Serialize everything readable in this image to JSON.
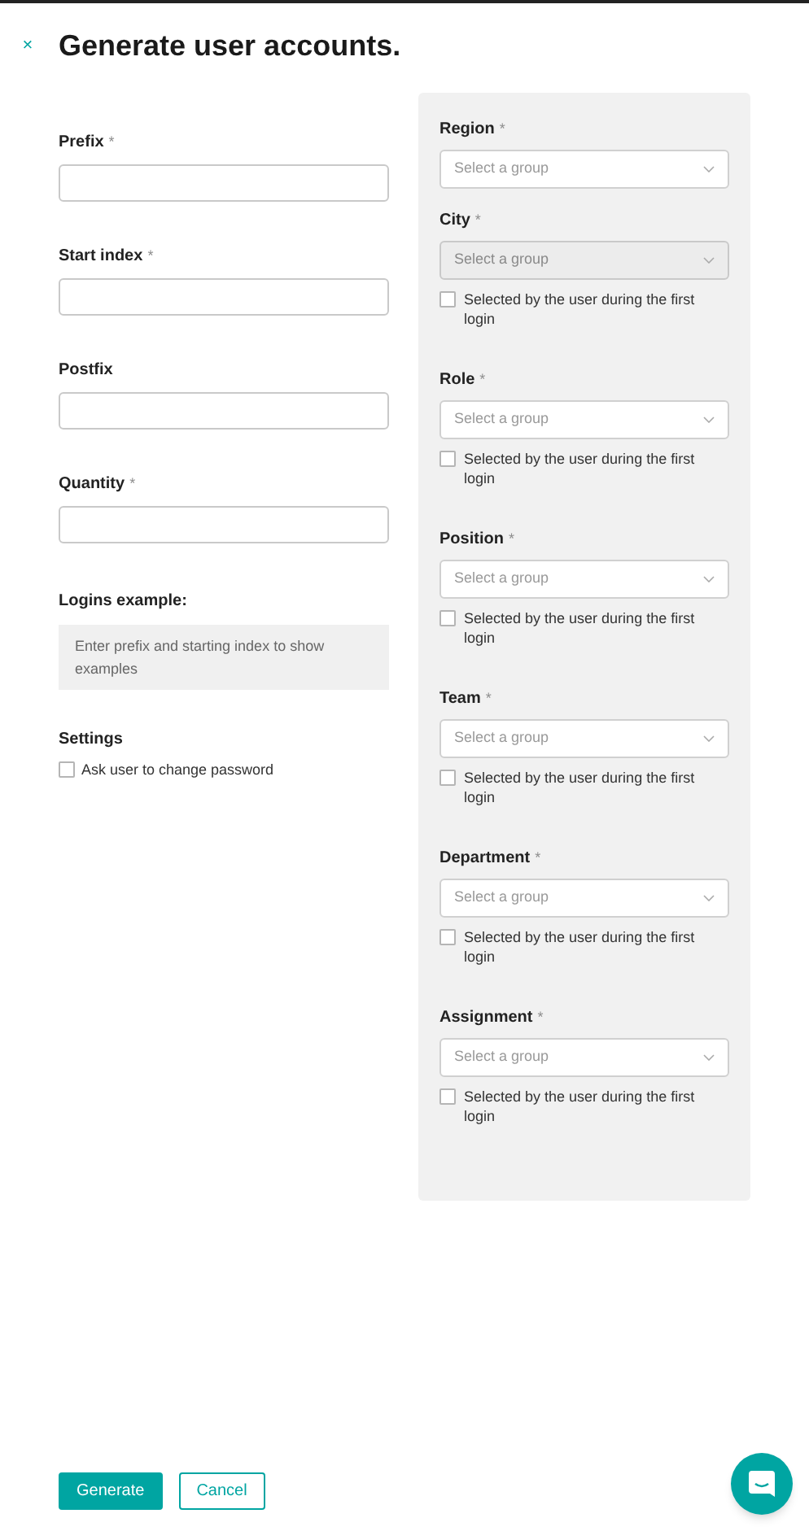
{
  "close": "×",
  "title": "Generate user accounts.",
  "fields": [
    {
      "label": "Prefix",
      "required": true
    },
    {
      "label": "Start index",
      "required": true
    },
    {
      "label": "Postfix",
      "required": false
    },
    {
      "label": "Quantity",
      "required": true
    }
  ],
  "required_mark": "*",
  "logins_example": {
    "label": "Logins example:",
    "hint": "Enter prefix and starting index to show examples"
  },
  "settings": {
    "label": "Settings",
    "options": [
      {
        "label": "Ask user to change password",
        "checked": false
      }
    ]
  },
  "groups": [
    {
      "label": "Region",
      "placeholder": "Select a group",
      "disabled": false
    },
    {
      "label": "City",
      "placeholder": "Select a group",
      "disabled": true,
      "option": {
        "label": "Selected by the user during the first login",
        "checked": false
      }
    },
    {
      "label": "Role",
      "placeholder": "Select a group",
      "disabled": false,
      "option": {
        "label": "Selected by the user during the first login",
        "checked": false
      }
    },
    {
      "label": "Position",
      "placeholder": "Select a group",
      "disabled": false,
      "option": {
        "label": "Selected by the user during the first login",
        "checked": false
      }
    },
    {
      "label": "Team",
      "placeholder": "Select a group",
      "disabled": false,
      "option": {
        "label": "Selected by the user during the first login",
        "checked": false
      }
    },
    {
      "label": "Department",
      "placeholder": "Select a group",
      "disabled": false,
      "option": {
        "label": "Selected by the user during the first login",
        "checked": false
      }
    },
    {
      "label": "Assignment",
      "placeholder": "Select a group",
      "disabled": false,
      "option": {
        "label": "Selected by the user during the first login",
        "checked": false
      }
    }
  ],
  "buttons": [
    {
      "label": "Generate",
      "kind": "primary"
    },
    {
      "label": "Cancel",
      "kind": "secondary"
    }
  ]
}
